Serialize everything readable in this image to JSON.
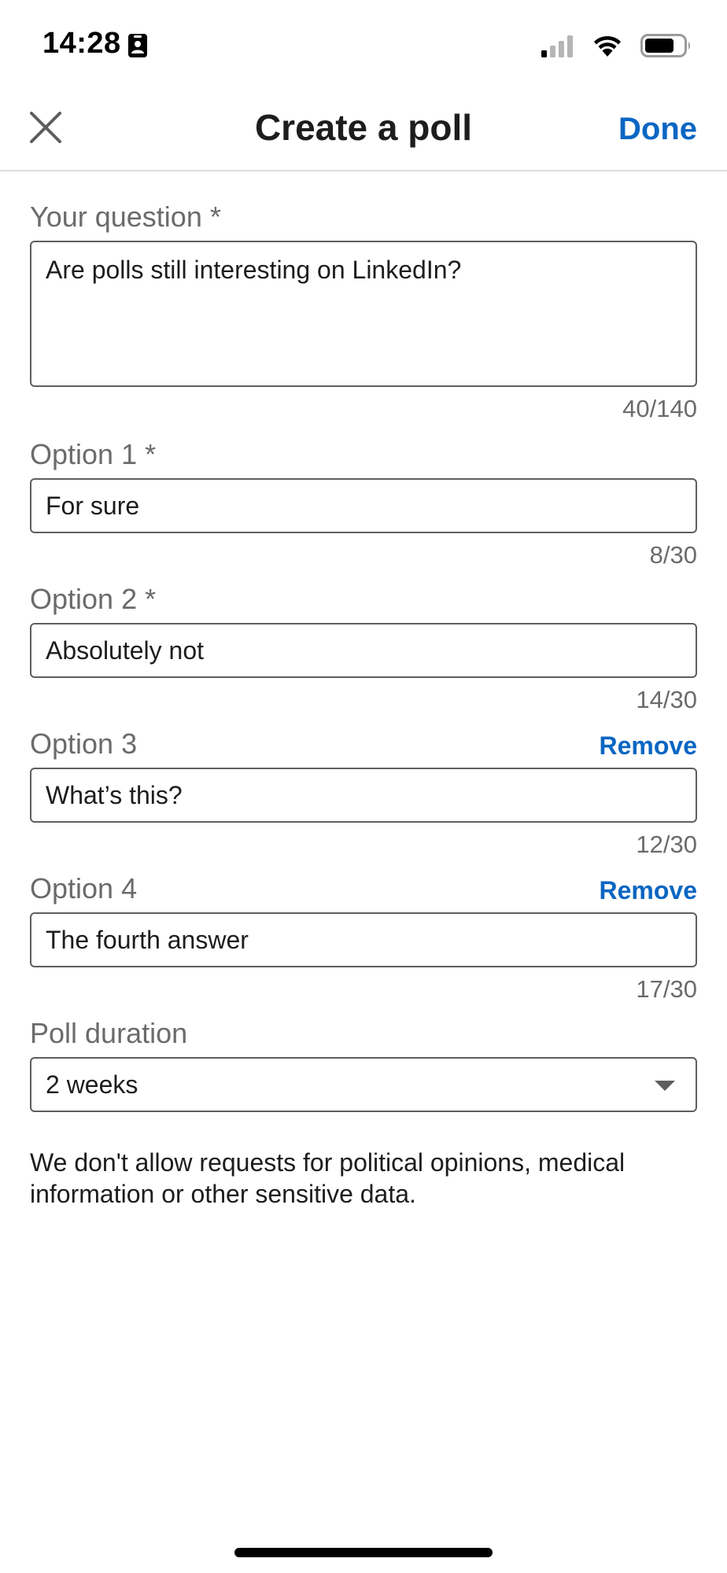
{
  "status_bar": {
    "time": "14:28",
    "icons": [
      "id-badge-icon",
      "signal-icon",
      "wifi-icon",
      "battery-icon"
    ]
  },
  "header": {
    "title": "Create a poll",
    "done_label": "Done",
    "close_icon": "close-icon"
  },
  "question": {
    "label": "Your question *",
    "value": "Are polls still interesting on LinkedIn?",
    "counter": "40/140"
  },
  "options": [
    {
      "label": "Option 1 *",
      "value": "For sure",
      "counter": "8/30",
      "remove_label": ""
    },
    {
      "label": "Option 2 *",
      "value": "Absolutely not",
      "counter": "14/30",
      "remove_label": ""
    },
    {
      "label": "Option 3",
      "value": "What’s this?",
      "counter": "12/30",
      "remove_label": "Remove"
    },
    {
      "label": "Option 4",
      "value": "The fourth answer",
      "counter": "17/30",
      "remove_label": "Remove"
    }
  ],
  "duration": {
    "label": "Poll duration",
    "selected": "2 weeks"
  },
  "disclaimer": "We don't allow requests for political opinions, medical information or other sensitive data.",
  "colors": {
    "accent": "#0a66c2",
    "label_gray": "#6b6b6b",
    "border": "#5e5e5e"
  }
}
